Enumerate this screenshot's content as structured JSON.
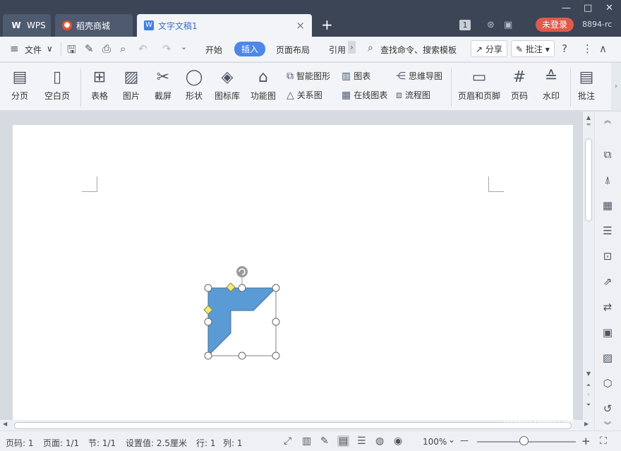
{
  "tabs": {
    "wps": "WPS",
    "shop": "稻壳商城",
    "doc": "文字文稿1",
    "new_tab": "+",
    "close": "×"
  },
  "titlebar": {
    "minimize": "—",
    "maximize": "□",
    "close": "✕",
    "badge": "1",
    "login": "未登录",
    "user_id": "8894-rc"
  },
  "menu": {
    "hamburger": "≡",
    "file": "文件",
    "file_arrow": "∨",
    "items": [
      "开始",
      "插入",
      "页面布局",
      "引用"
    ],
    "more": "›",
    "search": "查找命令、搜索模板",
    "share": "分享",
    "annotate": "批注",
    "help": "?",
    "kebab": "⋮",
    "collapse": "∧"
  },
  "ribbon": {
    "page_break": "分页",
    "blank_page": "空白页",
    "table": "表格",
    "picture": "图片",
    "screenshot": "截屏",
    "shape": "形状",
    "icon_lib": "图标库",
    "function_chart": "功能图",
    "smart_graphic": "智能图形",
    "chart": "图表",
    "mind_map": "思维导图",
    "relation_chart": "关系图",
    "online_chart": "在线图表",
    "flowchart": "流程图",
    "header_footer": "页眉和页脚",
    "page_number": "页码",
    "watermark": "水印",
    "comment": "批注"
  },
  "status": {
    "page_num": "页码: 1",
    "pages": "页面: 1/1",
    "section": "节: 1/1",
    "setting": "设置值: 2.5厘米",
    "row": "行: 1",
    "col": "列: 1",
    "zoom": "100%",
    "zoom_arrow": "⌄",
    "zoom_minus": "—",
    "zoom_plus": "+"
  },
  "watermark": {
    "text": "Bai 经验",
    "sub": "jingyan.baidu.com"
  },
  "colors": {
    "shape_fill": "#5b9bd5",
    "accent": "#4e88e6",
    "login": "#e05a4a"
  },
  "shape": {
    "type": "half-frame",
    "selected": true
  }
}
